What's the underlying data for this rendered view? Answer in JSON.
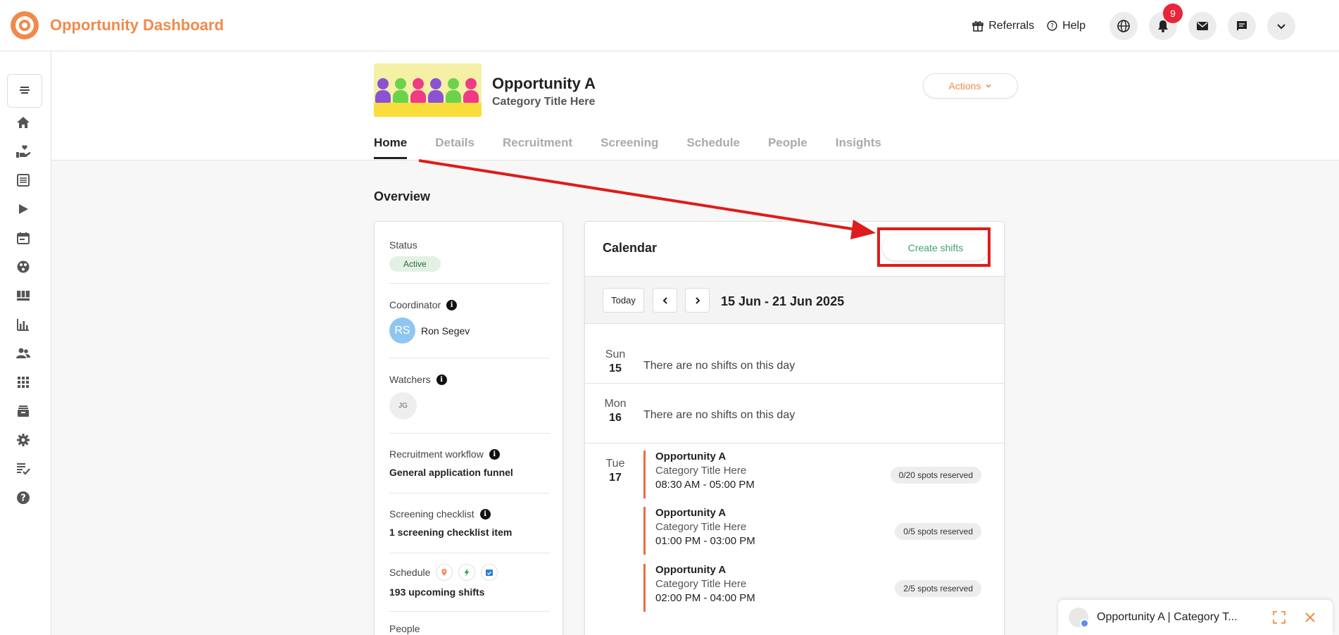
{
  "app": {
    "title": "Opportunity Dashboard"
  },
  "topbar": {
    "referrals": "Referrals",
    "help": "Help",
    "notifications_count": "9"
  },
  "opportunity": {
    "title": "Opportunity A",
    "category": "Category Title Here",
    "actions_label": "Actions"
  },
  "tabs": [
    {
      "label": "Home",
      "active": true
    },
    {
      "label": "Details"
    },
    {
      "label": "Recruitment"
    },
    {
      "label": "Screening"
    },
    {
      "label": "Schedule"
    },
    {
      "label": "People"
    },
    {
      "label": "Insights"
    }
  ],
  "overview": {
    "title": "Overview",
    "status_label": "Status",
    "status_value": "Active",
    "coordinator_label": "Coordinator",
    "coordinator_initials": "RS",
    "coordinator_name": "Ron Segev",
    "watchers_label": "Watchers",
    "watcher_initials": "JG",
    "workflow_label": "Recruitment workflow",
    "workflow_value": "General application funnel",
    "checklist_label": "Screening checklist",
    "checklist_value": "1 screening checklist item",
    "schedule_label": "Schedule",
    "schedule_value": "193 upcoming shifts",
    "people_label": "People"
  },
  "calendar": {
    "title": "Calendar",
    "create_label": "Create shifts",
    "today_label": "Today",
    "range": "15 Jun - 21 Jun 2025",
    "no_shifts_text": "There are no shifts on this day",
    "days": [
      {
        "name": "Sun",
        "num": "15"
      },
      {
        "name": "Mon",
        "num": "16"
      },
      {
        "name": "Tue",
        "num": "17"
      }
    ],
    "shifts": [
      {
        "title": "Opportunity A",
        "category": "Category Title Here",
        "time": "08:30 AM - 05:00 PM",
        "spots": "0/20 spots reserved"
      },
      {
        "title": "Opportunity A",
        "category": "Category Title Here",
        "time": "01:00 PM - 03:00 PM",
        "spots": "0/5 spots reserved"
      },
      {
        "title": "Opportunity A",
        "category": "Category Title Here",
        "time": "02:00 PM - 04:00 PM",
        "spots": "2/5 spots reserved"
      }
    ]
  },
  "floating_tab": {
    "label": "Opportunity A | Category T..."
  },
  "colors": {
    "brand": "#f08a4b",
    "accent_green": "#3fa36a",
    "annotation_red": "#e01b1b",
    "shift_bar": "#ef6a3e"
  },
  "icons": [
    "home-icon",
    "hand-heart-icon",
    "list-icon",
    "play-icon",
    "calendar-icon",
    "palette-icon",
    "board-icon",
    "bar-chart-icon",
    "people-icon",
    "apps-grid-icon",
    "inbox-icon",
    "gear-icon",
    "checklist-icon",
    "help-icon"
  ]
}
